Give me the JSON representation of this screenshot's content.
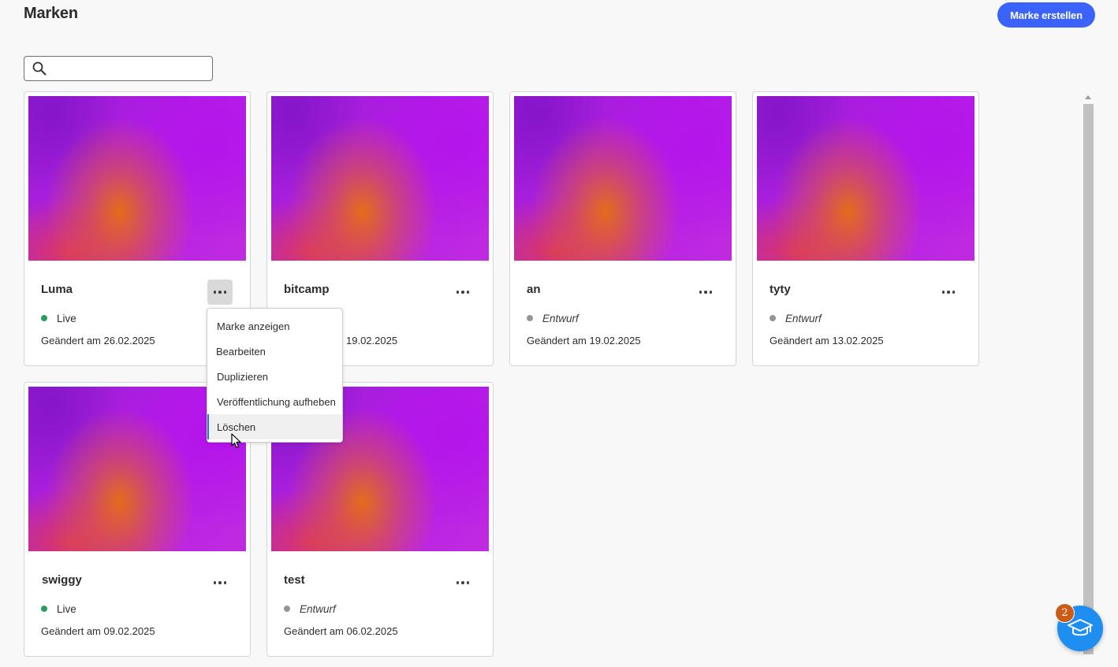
{
  "header": {
    "title": "Marken",
    "create_label": "Marke erstellen",
    "accent_color": "#3b63fb"
  },
  "search": {
    "value": "",
    "placeholder": "",
    "icon": "search-icon"
  },
  "cards": [
    {
      "name": "Luma",
      "status": "Live",
      "status_color": "#2d9d5f",
      "changed": "Geändert am 26.02.2025"
    },
    {
      "name": "bitcamp",
      "status": "",
      "status_color": "",
      "changed": "19.02.2025"
    },
    {
      "name": "an",
      "status": "Entwurf",
      "status_color": "#959595",
      "changed": "Geändert am 19.02.2025"
    },
    {
      "name": "tyty",
      "status": "Entwurf",
      "status_color": "#959595",
      "changed": "Geändert am 13.02.2025"
    },
    {
      "name": "swiggy",
      "status": "Live",
      "status_color": "#2d9d5f",
      "changed": "Geändert am 09.02.2025"
    },
    {
      "name": "test",
      "status": "Entwurf",
      "status_color": "#959595",
      "changed": "Geändert am 06.02.2025"
    }
  ],
  "context_menu": {
    "items": [
      "Marke anzeigen",
      "Bearbeiten",
      "Duplizieren",
      "Veröffentlichung aufheben",
      "Löschen"
    ],
    "hovered_item": "Löschen"
  },
  "help": {
    "badge_count": "2",
    "icon": "graduation-cap-icon",
    "color": "#1e8ef0",
    "badge_color": "#cb5c16"
  }
}
